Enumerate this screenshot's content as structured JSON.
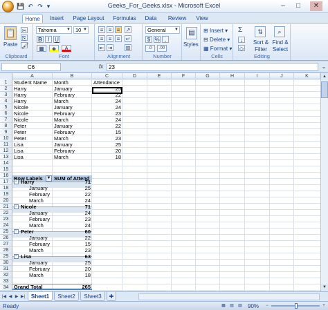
{
  "window": {
    "title": "Geeks_For_Geeks.xlsx - Microsoft Excel",
    "minimize": "–",
    "restore": "□",
    "close": "✕"
  },
  "quick_access": {
    "save": "💾",
    "undo": "↶",
    "redo": "↷",
    "more": "▾"
  },
  "tabs": [
    "Home",
    "Insert",
    "Page Layout",
    "Formulas",
    "Data",
    "Review",
    "View"
  ],
  "active_tab": "Home",
  "ribbon": {
    "clipboard": {
      "label": "Clipboard",
      "paste": "Paste"
    },
    "font": {
      "label": "Font",
      "family": "Tahoma",
      "size": "10",
      "bold": "B",
      "italic": "I",
      "underline": "U",
      "color_letter": "A"
    },
    "alignment": {
      "label": "Alignment"
    },
    "number": {
      "label": "Number",
      "format": "General",
      "currency": "$",
      "percent": "%",
      "comma": ",",
      "inc_dec": ".0",
      "dec_dec": ".00"
    },
    "styles": {
      "label": "Styles"
    },
    "cells": {
      "label": "Cells",
      "insert": "Insert",
      "delete": "Delete",
      "format": "Format"
    },
    "editing": {
      "label": "Editing",
      "sum": "Σ",
      "sort_filter": "Sort &",
      "sort_filter_2": "Filter",
      "find_select": "Find &",
      "find_select_2": "Select"
    }
  },
  "formula_bar": {
    "name_box": "C6",
    "fx": "fx",
    "formula": "23"
  },
  "columns": [
    "A",
    "B",
    "C",
    "D",
    "E",
    "F",
    "G",
    "H",
    "I",
    "J",
    "K"
  ],
  "rows": [
    "1",
    "2",
    "3",
    "4",
    "5",
    "6",
    "7",
    "8",
    "9",
    "10",
    "11",
    "12",
    "13",
    "14",
    "15",
    "16",
    "17",
    "18",
    "19",
    "20",
    "21",
    "22",
    "23",
    "24",
    "25",
    "26",
    "27",
    "28",
    "29",
    "30",
    "31",
    "32",
    "33",
    "34"
  ],
  "table": {
    "headers": [
      "Student Name",
      "Month",
      "Attendance"
    ],
    "rows": [
      [
        "Harry",
        "January",
        "25"
      ],
      [
        "Harry",
        "February",
        "22"
      ],
      [
        "Harry",
        "March",
        "24"
      ],
      [
        "Nicole",
        "January",
        "24"
      ],
      [
        "Nicole",
        "February",
        "23"
      ],
      [
        "Nicole",
        "March",
        "24"
      ],
      [
        "Peter",
        "January",
        "22"
      ],
      [
        "Peter",
        "February",
        "15"
      ],
      [
        "Peter",
        "March",
        "23"
      ],
      [
        "Lisa",
        "January",
        "25"
      ],
      [
        "Lisa",
        "February",
        "20"
      ],
      [
        "Lisa",
        "March",
        "18"
      ]
    ]
  },
  "pivot": {
    "row_labels": "Row Labels",
    "sum_header": "SUM of Attend",
    "groups": [
      {
        "name": "Harry",
        "total": "71",
        "months": [
          [
            "January",
            "25"
          ],
          [
            "February",
            "22"
          ],
          [
            "March",
            "24"
          ]
        ]
      },
      {
        "name": "Nicole",
        "total": "71",
        "months": [
          [
            "January",
            "24"
          ],
          [
            "February",
            "23"
          ],
          [
            "March",
            "24"
          ]
        ]
      },
      {
        "name": "Peter",
        "total": "60",
        "months": [
          [
            "January",
            "22"
          ],
          [
            "February",
            "15"
          ],
          [
            "March",
            "23"
          ]
        ]
      },
      {
        "name": "Lisa",
        "total": "63",
        "months": [
          [
            "January",
            "25"
          ],
          [
            "February",
            "20"
          ],
          [
            "March",
            "18"
          ]
        ]
      }
    ],
    "grand_total_label": "Grand Total",
    "grand_total": "265"
  },
  "sheets": [
    "Sheet1",
    "Sheet2",
    "Sheet3"
  ],
  "active_sheet": "Sheet1",
  "status": {
    "text": "Ready",
    "zoom": "90%"
  }
}
